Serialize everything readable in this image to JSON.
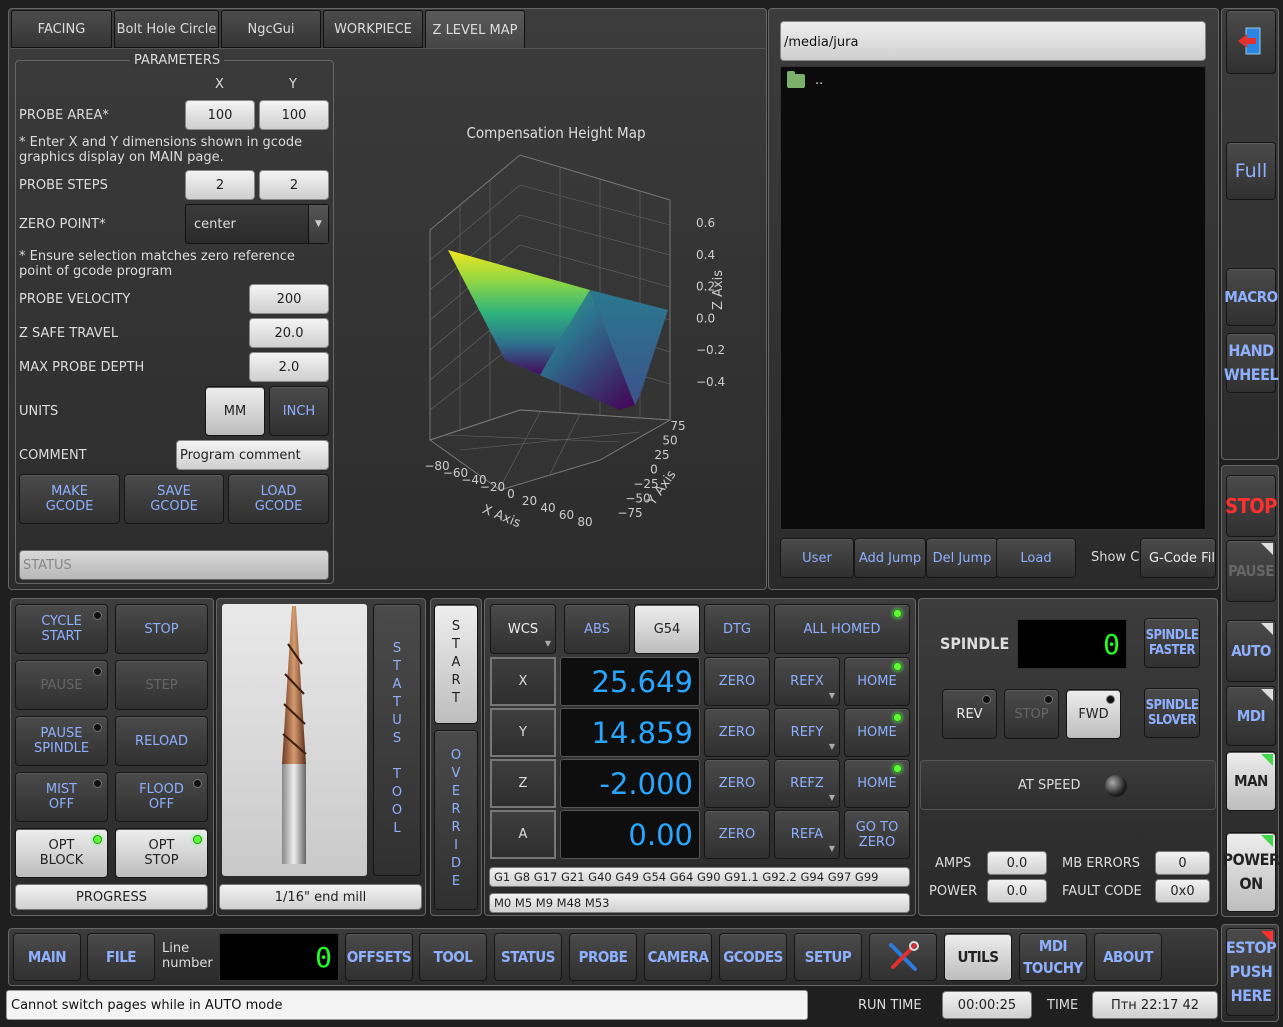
{
  "tabs": [
    "FACING",
    "Bolt Hole Circle",
    "NgcGui",
    "WORKPIECE",
    "Z LEVEL MAP"
  ],
  "params": {
    "title": "PARAMETERS",
    "col_x": "X",
    "col_y": "Y",
    "probe_area_label": "PROBE AREA*",
    "probe_area_x": "100",
    "probe_area_y": "100",
    "note1": "* Enter X and Y dimensions shown in gcode graphics display on MAIN page.",
    "probe_steps_label": "PROBE STEPS",
    "probe_steps_x": "2",
    "probe_steps_y": "2",
    "zero_point_label": "ZERO POINT*",
    "zero_point_value": "center",
    "note2": "* Ensure selection matches zero reference point of gcode program",
    "probe_velocity_label": "PROBE VELOCITY",
    "probe_velocity": "200",
    "z_safe_label": "Z SAFE TRAVEL",
    "z_safe": "20.0",
    "max_depth_label": "MAX PROBE DEPTH",
    "max_depth": "2.0",
    "units_label": "UNITS",
    "unit_mm": "MM",
    "unit_inch": "INCH",
    "comment_label": "COMMENT",
    "comment_value": "Program comment",
    "make_gcode": "MAKE GCODE",
    "save_gcode": "SAVE GCODE",
    "load_gcode": "LOAD GCODE",
    "status_placeholder": "STATUS"
  },
  "chart_data": {
    "type": "surface",
    "title": "Compensation Height Map",
    "xlabel": "X Axis",
    "ylabel": "Y Axis",
    "zlabel": "Z Axis",
    "xticks": [
      "−80",
      "−60",
      "−40",
      "−20",
      "0",
      "20",
      "40",
      "60",
      "80"
    ],
    "yticks": [
      "75",
      "50",
      "25",
      "0",
      "−25",
      "−50",
      "−75"
    ],
    "zticks": [
      "0.6",
      "0.4",
      "0.2",
      "0.0",
      "−0.2",
      "−0.4"
    ],
    "xlim": [
      -80,
      80
    ],
    "ylim": [
      -75,
      75
    ],
    "zlim": [
      -0.4,
      0.6
    ],
    "colormap": "viridis",
    "grid": true
  },
  "file": {
    "path": "/media/jura",
    "entries": [
      ".."
    ],
    "buttons": [
      "User",
      "Add Jump",
      "Del Jump",
      "Load"
    ],
    "show_label": "Show C",
    "filter": "G-Code Fil"
  },
  "right_bar": {
    "full": "Full",
    "macro": "MACRO",
    "handwheel": "HAND WHEEL",
    "stop": "STOP",
    "pause": "PAUSE",
    "auto": "AUTO",
    "mdi": "MDI",
    "man": "MAN",
    "power": "POWER ON",
    "estop": "ESTOP PUSH HERE"
  },
  "cycle": {
    "cycle_start": "CYCLE START",
    "stop": "STOP",
    "pause": "PAUSE",
    "step": "STEP",
    "pause_spindle": "PAUSE SPINDLE",
    "reload": "RELOAD",
    "mist": "MIST OFF",
    "flood": "FLOOD OFF",
    "opt_block": "OPT BLOCK",
    "opt_stop": "OPT STOP",
    "progress": "PROGRESS"
  },
  "tool": {
    "status_tool": "STATUS TOOL",
    "tool_name": "1/16\" end mill",
    "start": "START",
    "override": "OVERRIDE"
  },
  "dro": {
    "wcs": "WCS",
    "abs": "ABS",
    "g54": "G54",
    "dtg": "DTG",
    "all_homed": "ALL HOMED",
    "axes": [
      {
        "name": "X",
        "value": "25.649",
        "zero": "ZERO",
        "ref": "REFX",
        "home": "HOME"
      },
      {
        "name": "Y",
        "value": "14.859",
        "zero": "ZERO",
        "ref": "REFY",
        "home": "HOME"
      },
      {
        "name": "Z",
        "value": "-2.000",
        "zero": "ZERO",
        "ref": "REFZ",
        "home": "HOME"
      },
      {
        "name": "A",
        "value": "0.00",
        "zero": "ZERO",
        "ref": "REFA",
        "home": "GO TO ZERO"
      }
    ],
    "gcodes": "G1 G8 G17 G21 G40 G49 G54 G64 G90 G91.1 G92.2 G94 G97 G99",
    "mcodes": "M0 M5 M9 M48 M53"
  },
  "spindle": {
    "label": "SPINDLE",
    "speed": "0",
    "faster": "SPINDLE FASTER",
    "slower": "SPINDLE SLOVER",
    "rev": "REV",
    "stop": "STOP",
    "fwd": "FWD",
    "at_speed": "AT SPEED",
    "amps_label": "AMPS",
    "amps": "0.0",
    "power_label": "POWER",
    "power": "0.0",
    "mb_errors_label": "MB ERRORS",
    "mb_errors": "0",
    "fault_label": "FAULT CODE",
    "fault": "0x0"
  },
  "bottom": {
    "main": "MAIN",
    "file": "FILE",
    "line_label": "Line number",
    "line_value": "0",
    "offsets": "OFFSETS",
    "tool": "TOOL",
    "status": "STATUS",
    "probe": "PROBE",
    "camera": "CAMERA",
    "gcodes": "GCODES",
    "setup": "SETUP",
    "utils": "UTILS",
    "mdi_touchy": "MDI TOUCHY",
    "about": "ABOUT"
  },
  "statusbar": {
    "message": "Cannot switch pages while in AUTO mode",
    "run_time_label": "RUN TIME",
    "run_time": "00:00:25",
    "time_label": "TIME",
    "time": "Птн 22:17 42"
  }
}
